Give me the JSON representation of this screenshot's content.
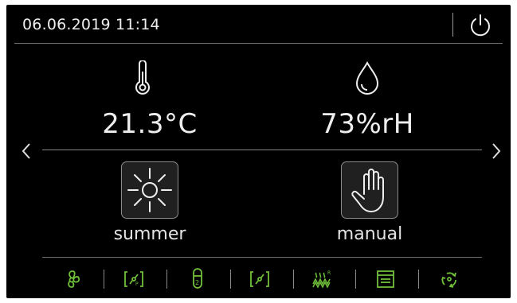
{
  "header": {
    "datetime": "06.06.2019 11:14",
    "power_icon": "power-icon"
  },
  "readings": {
    "temperature": {
      "value": "21.3°C",
      "icon": "thermometer-icon"
    },
    "humidity": {
      "value": "73%rH",
      "icon": "droplet-icon"
    }
  },
  "navigation": {
    "prev_icon": "chevron-left-icon",
    "next_icon": "chevron-right-icon"
  },
  "modes": {
    "season": {
      "label": "summer",
      "icon": "sun-icon"
    },
    "operation": {
      "label": "manual",
      "icon": "hand-icon"
    }
  },
  "status_bar": {
    "accent_color": "#6fbf3a",
    "icons": [
      "fan-icon",
      "pressure-sensor-icon",
      "filter-2-icon",
      "sensor-icon",
      "heater-r-icon",
      "window-icon",
      "recirculation-icon"
    ]
  },
  "colors": {
    "background": "#000000",
    "text": "#eeeeee",
    "accent": "#6fbf3a"
  }
}
